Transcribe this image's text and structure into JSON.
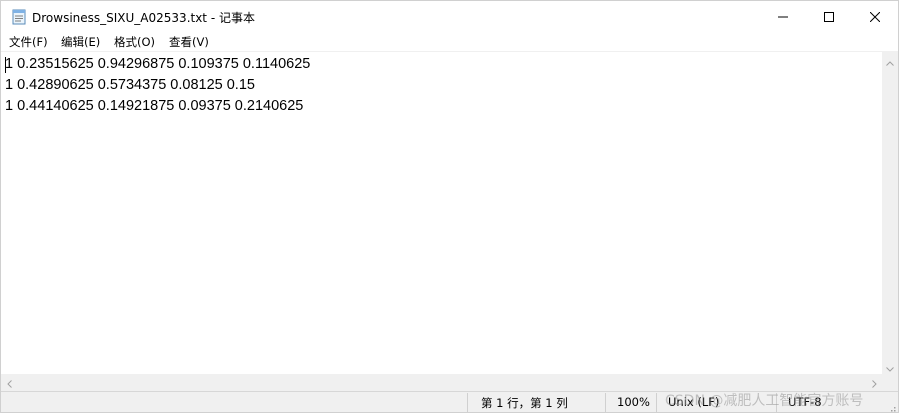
{
  "window": {
    "title": "Drowsiness_SIXU_A02533.txt - 记事本",
    "icons": {
      "app": "notepad-icon",
      "minimize": "minimize-icon",
      "maximize": "maximize-icon",
      "close": "close-icon"
    }
  },
  "menu": {
    "file": "文件(F)",
    "edit": "编辑(E)",
    "format": "格式(O)",
    "view": "查看(V)"
  },
  "editor": {
    "lines": [
      "1 0.23515625 0.94296875 0.109375 0.1140625",
      "1 0.42890625 0.5734375 0.08125 0.15",
      "1 0.44140625 0.14921875 0.09375 0.2140625"
    ]
  },
  "status": {
    "position": "第 1 行，第 1 列",
    "zoom": "100%",
    "line_ending": "Unix (LF)",
    "encoding": "UTF-8"
  },
  "watermark": "CSDN @减肥人工智能官方账号",
  "colors": {
    "scrollbar_bg": "#f0f0f0",
    "status_bg": "#f0f0f0"
  }
}
